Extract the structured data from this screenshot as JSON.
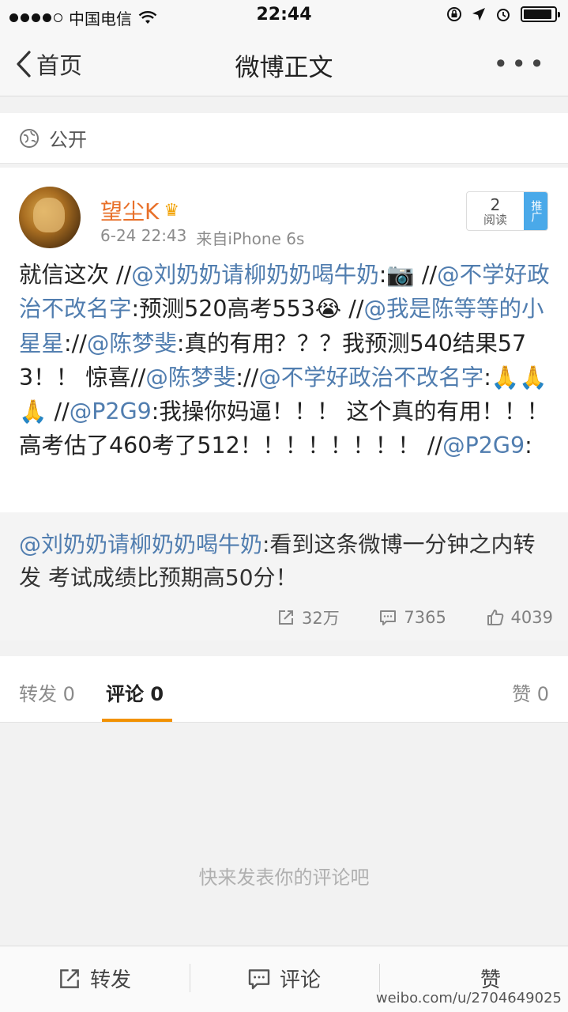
{
  "status_bar": {
    "carrier": "中国电信",
    "time": "22:44"
  },
  "nav": {
    "back_label": "首页",
    "title": "微博正文",
    "more": "•••"
  },
  "visibility": {
    "label": "公开"
  },
  "post": {
    "username": "望尘K",
    "time": "6-24 22:43",
    "source": "来自iPhone 6s",
    "reads": {
      "count": "2",
      "label": "阅读"
    },
    "promo_label": "推广",
    "text": {
      "p1": "就信这次 //",
      "m1": "@刘奶奶请柳奶奶喝牛奶",
      "p2": ":📷 //",
      "m2": "@不学好政治不改名字",
      "p3": ":预测520高考553😭 //",
      "m3": "@我是陈等等的小星星",
      "p4": "://",
      "m4": "@陈梦斐",
      "p5": ":真的有用？？？我预测540结果573！！ 惊喜//",
      "m5": "@陈梦斐",
      "p6": "://",
      "m6": "@不学好政治不改名字",
      "p7": ":🙏🙏🙏 //",
      "m7": "@P2G9",
      "p8": ":我操你妈逼！！！ 这个真的有用！！！ 高考估了460考了512！！！！！！！！ //",
      "m8": "@P2G9",
      "p9": ":"
    },
    "repost": {
      "mention": "@刘奶奶请柳奶奶喝牛奶",
      "text": ":看到这条微博一分钟之内转发 考试成绩比预期高50分！"
    },
    "actions": {
      "repost_count": "32万",
      "comment_count": "7365",
      "like_count": "4039"
    }
  },
  "tabs": {
    "repost": "转发 0",
    "comment": "评论 0",
    "like": "赞 0"
  },
  "empty_hint": "快来发表你的评论吧",
  "toolbar": {
    "repost": "转发",
    "comment": "评论",
    "like": "赞"
  },
  "watermark": "weibo.com/u/2704649025"
}
